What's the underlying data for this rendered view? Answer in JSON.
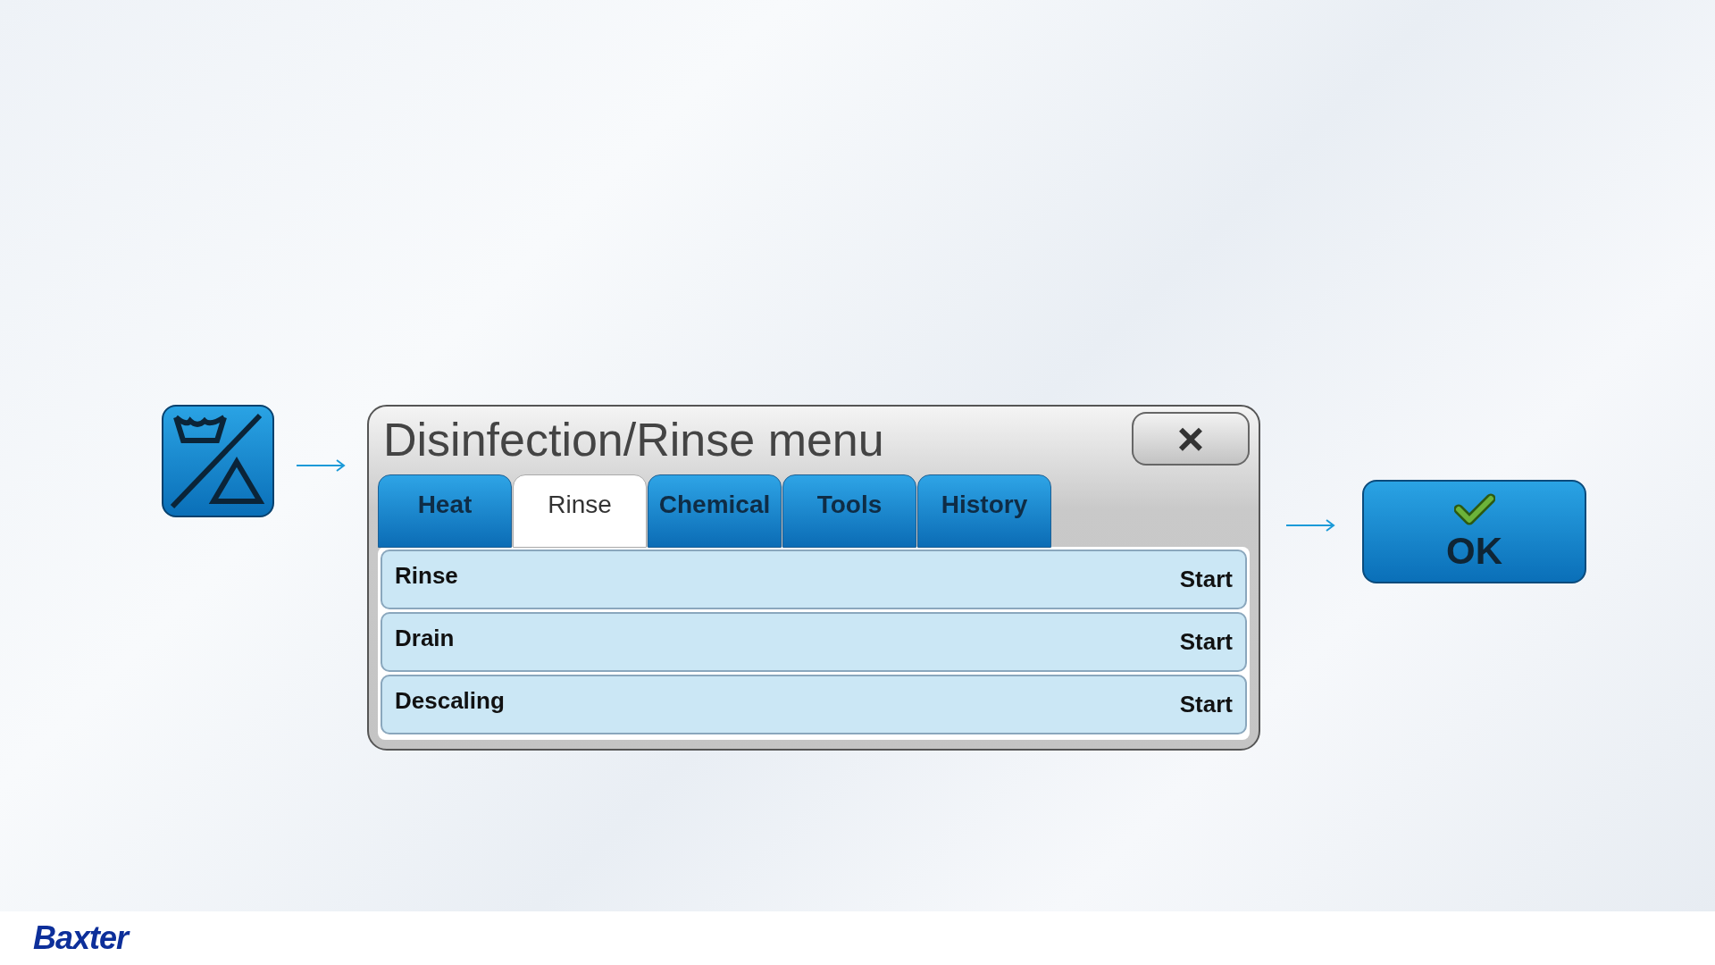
{
  "dialog": {
    "title": "Disinfection/Rinse menu",
    "close": "×",
    "tabs": [
      {
        "label": "Heat",
        "selected": false
      },
      {
        "label": "Rinse",
        "selected": true
      },
      {
        "label": "Chemical",
        "selected": false
      },
      {
        "label": "Tools",
        "selected": false
      },
      {
        "label": "History",
        "selected": false
      }
    ],
    "rows": [
      {
        "label": "Rinse",
        "action": "Start"
      },
      {
        "label": "Drain",
        "action": "Start"
      },
      {
        "label": "Descaling",
        "action": "Start"
      }
    ]
  },
  "ok_button": {
    "label": "OK"
  },
  "footer": {
    "logo": "Baxter"
  }
}
